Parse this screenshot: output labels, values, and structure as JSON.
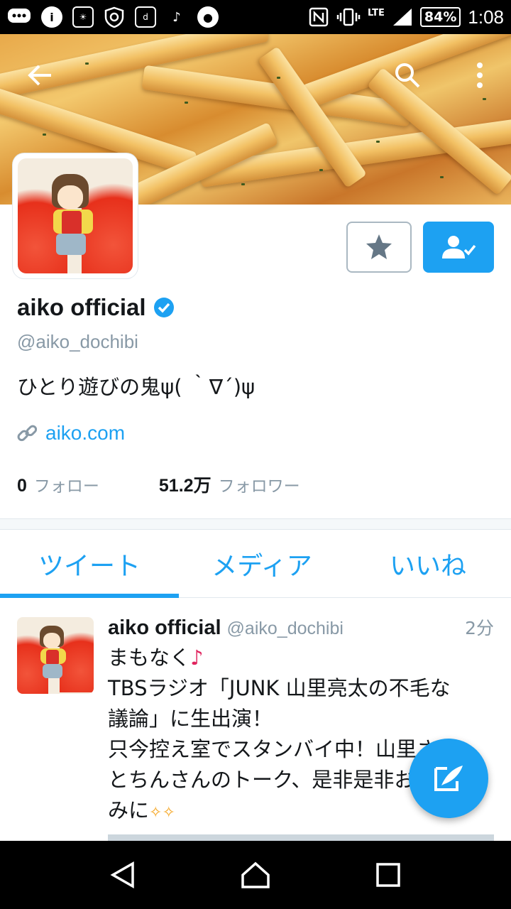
{
  "status_bar": {
    "battery": "84%",
    "time": "1:08",
    "network": "LTE"
  },
  "header": {
    "back_icon": "arrow-left-icon",
    "search_icon": "search-icon",
    "more_icon": "more-vertical-icon"
  },
  "profile": {
    "name": "aiko official",
    "handle": "@aiko_dochibi",
    "bio": "ひとり遊びの鬼ψ( ｀∇´)ψ",
    "link": "aiko.com",
    "following_count": "0",
    "following_label": "フォロー",
    "followers_count": "51.2万",
    "followers_label": "フォロワー",
    "verified": true
  },
  "tabs": [
    {
      "label": "ツイート",
      "active": true
    },
    {
      "label": "メディア",
      "active": false
    },
    {
      "label": "いいね",
      "active": false
    }
  ],
  "tweet": {
    "name": "aiko official",
    "handle": "@aiko_dochibi",
    "time": "2分",
    "line1": "まもなく",
    "note": "♪",
    "line2": "TBSラジオ「JUNK 山里亮太の不毛な",
    "line3": "議論」に生出演！",
    "line4": "只今控え室でスタンバイ中！山里さん",
    "line5": "とちんさんのトーク、是非是非お楽し",
    "line6": "みに",
    "sparkles": "✧✧"
  },
  "colors": {
    "accent": "#1da1f2",
    "secondary_text": "#8899a6"
  }
}
